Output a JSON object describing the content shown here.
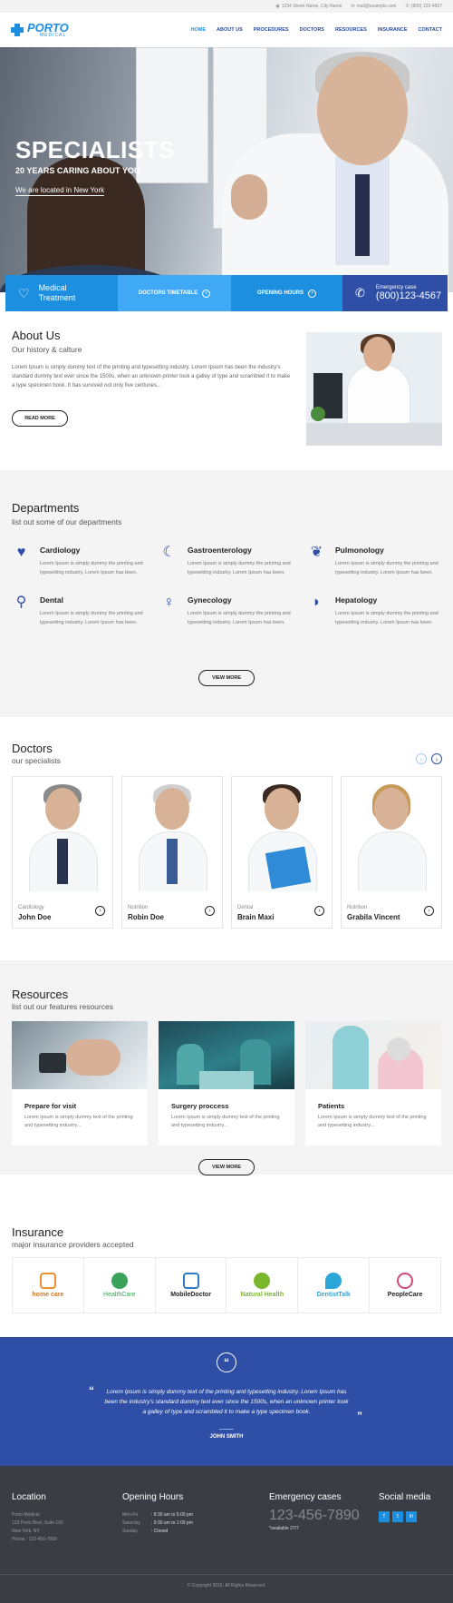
{
  "topbar": {
    "address": "1234 Street Name, City Name",
    "email": "mail@example.com",
    "phone": "(800) 123-4567"
  },
  "logo": {
    "title": "PORTO",
    "sub": "MEDICAL"
  },
  "nav": [
    "HOME",
    "ABOUT US",
    "PROCEDURES",
    "DOCTORS",
    "RESOURCES",
    "INSURANCE",
    "CONTACT"
  ],
  "hero": {
    "title": "SPECIALISTS",
    "subtitle": "20 YEARS CARING ABOUT YOU.",
    "location": "We are located in New York"
  },
  "strip": {
    "treatment": "Medical Treatment",
    "timetable": "DOCTORS TIMETABLE",
    "hours": "OPENING HOURS",
    "emergency_label": "Emergency case",
    "emergency_phone": "(800)123-4567"
  },
  "about": {
    "title": "About Us",
    "subtitle": "Our history & calture",
    "text": "Lorem Ipsum is simply dummy text of the printing and typesetting industry. Lorem Ipsum has been the industry's standard dummy text ever since the 1500s, when an unknown printer took a galley of type and scrambled it to make a type specimen book. It has survived not only five centuries...",
    "button": "READ MORE"
  },
  "departments": {
    "title": "Departments",
    "subtitle": "list out some of our departments",
    "items": [
      {
        "name": "Cardiology",
        "icon": "heart-icon",
        "desc": "Lorem Ipsum is simply dummy the printing and typesetting industry. Lorem Ipsum has been."
      },
      {
        "name": "Gastroenterology",
        "icon": "stomach-icon",
        "desc": "Lorem Ipsum is simply dummy the printing and typesetting industry. Lorem Ipsum has been."
      },
      {
        "name": "Pulmonology",
        "icon": "lungs-icon",
        "desc": "Lorem Ipsum is simply dummy the printing and typesetting industry. Lorem Ipsum has been."
      },
      {
        "name": "Dental",
        "icon": "tooth-icon",
        "desc": "Lorem Ipsum is simply dummy the printing and typesetting industry. Lorem Ipsum has been."
      },
      {
        "name": "Gynecology",
        "icon": "uterus-icon",
        "desc": "Lorem Ipsum is simply dummy the printing and typesetting industry. Lorem Ipsum has been."
      },
      {
        "name": "Hepatology",
        "icon": "liver-icon",
        "desc": "Lorem Ipsum is simply dummy the printing and typesetting industry. Lorem Ipsum has been."
      }
    ],
    "button": "VIEW MORE"
  },
  "doctors": {
    "title": "Doctors",
    "subtitle": "our specialists",
    "items": [
      {
        "spec": "Cardiology",
        "name": "John Doe"
      },
      {
        "spec": "Nutrition",
        "name": "Robin Doe"
      },
      {
        "spec": "Dental",
        "name": "Brain Maxi"
      },
      {
        "spec": "Nutrition",
        "name": "Grabila Vincent"
      }
    ]
  },
  "resources": {
    "title": "Resources",
    "subtitle": "list out our features resources",
    "items": [
      {
        "title": "Prepare for visit",
        "desc": "Lorem Ipsum is simply dummy text of the printing and typesetting industry..."
      },
      {
        "title": "Surgery proccess",
        "desc": "Lorem Ipsum is simply dummy text of the printing and typesetting industry..."
      },
      {
        "title": "Patients",
        "desc": "Lorem Ipsum is simply dummy text of the printing and typesetting industry..."
      }
    ],
    "button": "VIEW MORE"
  },
  "insurance": {
    "title": "Insurance",
    "subtitle": "major insurance providers accepted",
    "providers": [
      {
        "name": "home care",
        "color": "#c77a2a"
      },
      {
        "name": "HealthCare",
        "color": "#3aa35a"
      },
      {
        "name": "MobileDoctor",
        "color": "#2e7bc8"
      },
      {
        "name": "Natural Health",
        "color": "#7ab62c"
      },
      {
        "name": "DentistTalk",
        "color": "#2aa7d8"
      },
      {
        "name": "PeopleCare",
        "color": "#d04a7a"
      }
    ]
  },
  "testimonial": {
    "quote": "Lorem Ipsum is simply dummy text of the printing and typesetting industry. Lorem Ipsum has been the industry's standard dummy text ever since the 1500s, when an unknown printer took a galley of type and scrambled it to make a type specimen book.",
    "author": "JOHN SMITH"
  },
  "footer": {
    "location_title": "Location",
    "location_lines": [
      "Porto Medical",
      "123 Porto Blvd, Suite 100",
      "New York, NY",
      "Phone : 123-456-7890"
    ],
    "hours_title": "Opening Hours",
    "hours": [
      {
        "day": "Mon-Fri",
        "time": ": 8:30 am to 5:00 pm"
      },
      {
        "day": "Saturday",
        "time": ": 9:30 am to 1:00 pm"
      },
      {
        "day": "Sunday",
        "time": ": Closed"
      }
    ],
    "emergency_title": "Emergency cases",
    "emergency_phone": "123-456-7890",
    "emergency_avail": "*available 27/7",
    "social_title": "Social media",
    "socials": [
      "f",
      "t",
      "in"
    ],
    "copyright": "© Copyright 2016. All Rights Reserved."
  },
  "colors": {
    "primary": "#1d8fe1",
    "navy": "#2e4fa5",
    "footer": "#3a3d44"
  }
}
